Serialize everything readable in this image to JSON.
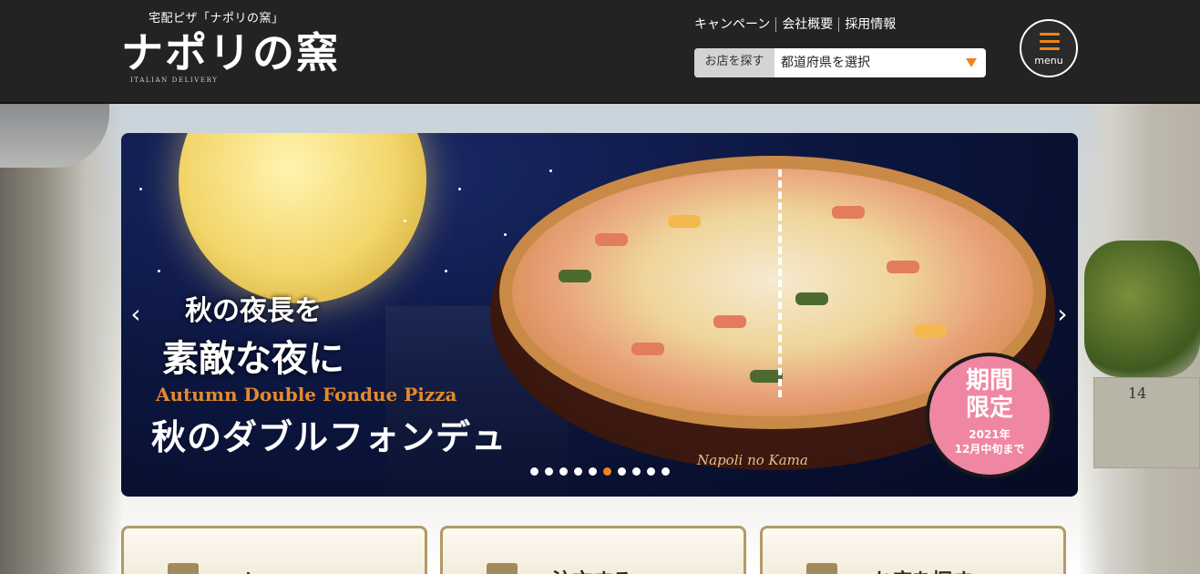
{
  "header": {
    "logo_tagline": "宅配ピザ「ナポリの窯」",
    "logo_text": "ナポリの窯",
    "logo_sub": "ITALIAN DELIVERY",
    "nav": [
      "キャンペーン",
      "会社概要",
      "採用情報"
    ],
    "store_label": "お店を探す",
    "store_select": "都道府県を選択",
    "menu_label": "menu"
  },
  "hero": {
    "line1": "秋の夜長を",
    "line2": "素敵な夜に",
    "en_title": "Autumn Double Fondue Pizza",
    "jp_title": "秋のダブルフォンデュ",
    "brand_script": "Napoli no Kama",
    "badge_main": "期間\n限定",
    "badge_sub": "2021年\n12月中旬まで",
    "dots_total": 10,
    "dots_active": 5
  },
  "bg": {
    "building_number": "14"
  },
  "cards": [
    {
      "label": "メ"
    },
    {
      "label": "注文する"
    },
    {
      "label": "お店を探す"
    }
  ]
}
